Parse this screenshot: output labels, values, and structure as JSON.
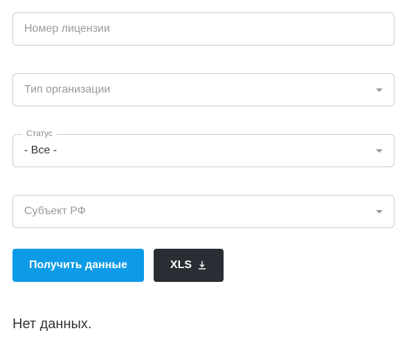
{
  "fields": {
    "license": {
      "placeholder": "Номер лицензии",
      "value": ""
    },
    "orgType": {
      "placeholder": "Тип организации",
      "value": ""
    },
    "status": {
      "label": "Статус",
      "value": "- Все -"
    },
    "region": {
      "placeholder": "Субъект РФ",
      "value": ""
    }
  },
  "buttons": {
    "submit": "Получить данные",
    "export": "XLS"
  },
  "result": {
    "noData": "Нет данных."
  }
}
